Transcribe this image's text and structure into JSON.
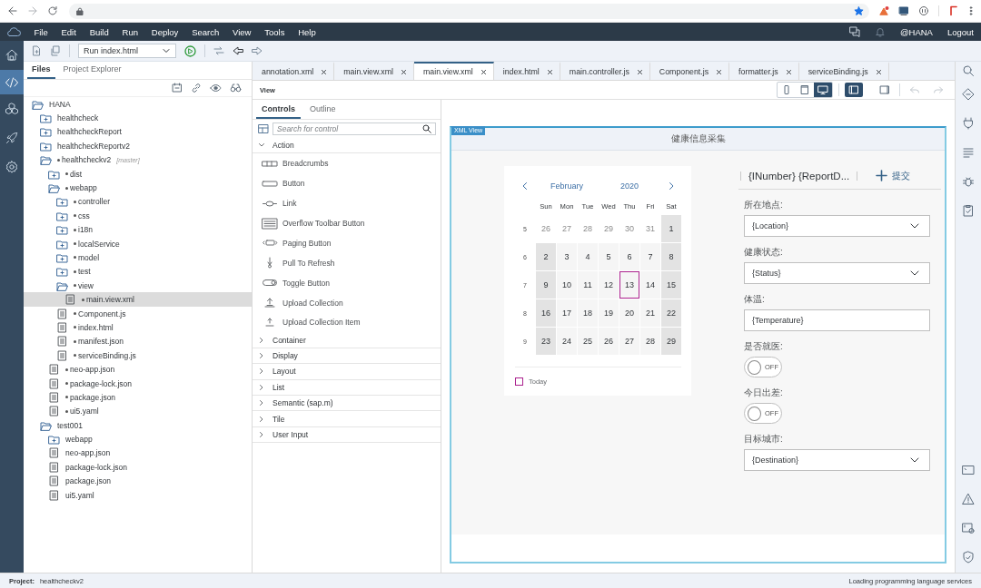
{
  "menubar": {
    "menus": [
      "File",
      "Edit",
      "Build",
      "Run",
      "Deploy",
      "Search",
      "View",
      "Tools",
      "Help"
    ],
    "user": "@HANA",
    "logout": "Logout"
  },
  "left_rail": [
    {
      "selected": false
    },
    {
      "selected": true
    },
    {
      "selected": false
    },
    {
      "selected": false
    },
    {
      "selected": false
    }
  ],
  "toolbar": {
    "run_config": "Run index.html"
  },
  "files": {
    "tabs": [
      {
        "label": "Files",
        "selected": true
      },
      {
        "label": "Project Explorer",
        "selected": false
      }
    ],
    "tree": [
      {
        "name": "HANA",
        "kind": "folder",
        "expanded": true,
        "modified": false,
        "selected": false,
        "children": [
          {
            "name": "healthcheck",
            "kind": "folder",
            "expanded": false,
            "modified": false,
            "selected": false
          },
          {
            "name": "healthcheckReport",
            "kind": "folder",
            "expanded": false,
            "modified": false,
            "selected": false
          },
          {
            "name": "healthcheckReportv2",
            "kind": "folder",
            "expanded": false,
            "modified": false,
            "selected": false
          },
          {
            "name": "healthcheckv2",
            "kind": "folder",
            "expanded": true,
            "modified": true,
            "selected": false,
            "branch": "[master]",
            "children": [
              {
                "name": "dist",
                "kind": "folder",
                "expanded": false,
                "modified": true,
                "selected": false
              },
              {
                "name": "webapp",
                "kind": "folder",
                "expanded": true,
                "modified": true,
                "selected": false,
                "children": [
                  {
                    "name": "controller",
                    "kind": "folder",
                    "expanded": false,
                    "modified": true,
                    "selected": false
                  },
                  {
                    "name": "css",
                    "kind": "folder",
                    "expanded": false,
                    "modified": true,
                    "selected": false
                  },
                  {
                    "name": "i18n",
                    "kind": "folder",
                    "expanded": false,
                    "modified": true,
                    "selected": false
                  },
                  {
                    "name": "localService",
                    "kind": "folder",
                    "expanded": false,
                    "modified": true,
                    "selected": false
                  },
                  {
                    "name": "model",
                    "kind": "folder",
                    "expanded": false,
                    "modified": true,
                    "selected": false
                  },
                  {
                    "name": "test",
                    "kind": "folder",
                    "expanded": false,
                    "modified": true,
                    "selected": false
                  },
                  {
                    "name": "view",
                    "kind": "folder",
                    "expanded": true,
                    "modified": true,
                    "selected": false,
                    "children": [
                      {
                        "name": "main.view.xml",
                        "kind": "file",
                        "modified": true,
                        "selected": true
                      }
                    ]
                  },
                  {
                    "name": "Component.js",
                    "kind": "file",
                    "modified": true,
                    "selected": false
                  },
                  {
                    "name": "index.html",
                    "kind": "file",
                    "modified": true,
                    "selected": false
                  },
                  {
                    "name": "manifest.json",
                    "kind": "file",
                    "modified": true,
                    "selected": false
                  },
                  {
                    "name": "serviceBinding.js",
                    "kind": "file",
                    "modified": true,
                    "selected": false
                  }
                ]
              },
              {
                "name": "neo-app.json",
                "kind": "file",
                "modified": true,
                "selected": false
              },
              {
                "name": "package-lock.json",
                "kind": "file",
                "modified": true,
                "selected": false
              },
              {
                "name": "package.json",
                "kind": "file",
                "modified": true,
                "selected": false
              },
              {
                "name": "ui5.yaml",
                "kind": "file",
                "modified": true,
                "selected": false
              }
            ]
          },
          {
            "name": "test001",
            "kind": "folder",
            "expanded": true,
            "modified": false,
            "selected": false,
            "children": [
              {
                "name": "webapp",
                "kind": "folder",
                "expanded": false,
                "modified": false,
                "selected": false
              },
              {
                "name": "neo-app.json",
                "kind": "file",
                "modified": false,
                "selected": false
              },
              {
                "name": "package-lock.json",
                "kind": "file",
                "modified": false,
                "selected": false
              },
              {
                "name": "package.json",
                "kind": "file",
                "modified": false,
                "selected": false
              },
              {
                "name": "ui5.yaml",
                "kind": "file",
                "modified": false,
                "selected": false
              }
            ]
          }
        ]
      }
    ]
  },
  "editor_tabs": [
    {
      "label": "annotation.xml",
      "selected": false
    },
    {
      "label": "main.view.xml",
      "selected": false
    },
    {
      "label": "main.view.xml",
      "selected": true
    },
    {
      "label": "index.html",
      "selected": false
    },
    {
      "label": "main.controller.js",
      "selected": false
    },
    {
      "label": "Component.js",
      "selected": false
    },
    {
      "label": "formatter.js",
      "selected": false
    },
    {
      "label": "serviceBinding.js",
      "selected": false
    }
  ],
  "view_toolbar": {
    "label": "View",
    "devices": [
      {
        "selected": false
      },
      {
        "selected": false
      },
      {
        "selected": true
      }
    ],
    "panes": [
      {
        "selected": true
      },
      {
        "selected": false
      }
    ],
    "history": [
      {
        "disabled": true
      },
      {
        "disabled": true
      }
    ]
  },
  "controls": {
    "tabs": [
      {
        "label": "Controls",
        "selected": true
      },
      {
        "label": "Outline",
        "selected": false
      }
    ],
    "search": {
      "placeholder": "Search for control"
    },
    "groups": [
      {
        "label": "Action",
        "expanded": true,
        "items": [
          {
            "label": "Breadcrumbs"
          },
          {
            "label": "Button"
          },
          {
            "label": "Link"
          },
          {
            "label": "Overflow Toolbar Button"
          },
          {
            "label": "Paging Button"
          },
          {
            "label": "Pull To Refresh"
          },
          {
            "label": "Toggle Button"
          },
          {
            "label": "Upload Collection"
          },
          {
            "label": "Upload Collection Item"
          }
        ]
      },
      {
        "label": "Container",
        "expanded": false
      },
      {
        "label": "Display",
        "expanded": false
      },
      {
        "label": "Layout",
        "expanded": false
      },
      {
        "label": "List",
        "expanded": false
      },
      {
        "label": "Semantic (sap.m)",
        "expanded": false
      },
      {
        "label": "Tile",
        "expanded": false
      },
      {
        "label": "User Input",
        "expanded": false
      }
    ]
  },
  "preview": {
    "badge": "XML View",
    "title": "健康信息采集",
    "calendar": {
      "month": "February",
      "year": "2020",
      "weekdays": [
        "Sun",
        "Mon",
        "Tue",
        "Wed",
        "Thu",
        "Fri",
        "Sat"
      ],
      "weeks": [
        {
          "number": "5",
          "days": [
            {
              "label": "26",
              "kind": "other",
              "today": false
            },
            {
              "label": "27",
              "kind": "other",
              "today": false
            },
            {
              "label": "28",
              "kind": "other",
              "today": false
            },
            {
              "label": "29",
              "kind": "other",
              "today": false
            },
            {
              "label": "30",
              "kind": "other",
              "today": false
            },
            {
              "label": "31",
              "kind": "other",
              "today": false
            },
            {
              "label": "1",
              "kind": "weekend",
              "today": false
            }
          ]
        },
        {
          "number": "6",
          "days": [
            {
              "label": "2",
              "kind": "weekend",
              "today": false
            },
            {
              "label": "3",
              "kind": "day",
              "today": false
            },
            {
              "label": "4",
              "kind": "day",
              "today": false
            },
            {
              "label": "5",
              "kind": "day",
              "today": false
            },
            {
              "label": "6",
              "kind": "day",
              "today": false
            },
            {
              "label": "7",
              "kind": "day",
              "today": false
            },
            {
              "label": "8",
              "kind": "weekend",
              "today": false
            }
          ]
        },
        {
          "number": "7",
          "days": [
            {
              "label": "9",
              "kind": "weekend",
              "today": false
            },
            {
              "label": "10",
              "kind": "day",
              "today": false
            },
            {
              "label": "11",
              "kind": "day",
              "today": false
            },
            {
              "label": "12",
              "kind": "day",
              "today": false
            },
            {
              "label": "13",
              "kind": "day",
              "today": true
            },
            {
              "label": "14",
              "kind": "day",
              "today": false
            },
            {
              "label": "15",
              "kind": "weekend",
              "today": false
            }
          ]
        },
        {
          "number": "8",
          "days": [
            {
              "label": "16",
              "kind": "weekend",
              "today": false
            },
            {
              "label": "17",
              "kind": "day",
              "today": false
            },
            {
              "label": "18",
              "kind": "day",
              "today": false
            },
            {
              "label": "19",
              "kind": "day",
              "today": false
            },
            {
              "label": "20",
              "kind": "day",
              "today": false
            },
            {
              "label": "21",
              "kind": "day",
              "today": false
            },
            {
              "label": "22",
              "kind": "weekend",
              "today": false
            }
          ]
        },
        {
          "number": "9",
          "days": [
            {
              "label": "23",
              "kind": "weekend",
              "today": false
            },
            {
              "label": "24",
              "kind": "day",
              "today": false
            },
            {
              "label": "25",
              "kind": "day",
              "today": false
            },
            {
              "label": "26",
              "kind": "day",
              "today": false
            },
            {
              "label": "27",
              "kind": "day",
              "today": false
            },
            {
              "label": "28",
              "kind": "day",
              "today": false
            },
            {
              "label": "29",
              "kind": "weekend",
              "today": false
            }
          ]
        }
      ],
      "legend": "Today"
    },
    "form": {
      "title": "{INumber} {ReportD...",
      "action": "提交",
      "fields": [
        {
          "label": "所在地点:",
          "kind": "select",
          "value": "{Location}"
        },
        {
          "label": "健康状态:",
          "kind": "select",
          "value": "{Status}"
        },
        {
          "label": "体温:",
          "kind": "input",
          "value": "{Temperature}"
        },
        {
          "label": "是否就医:",
          "kind": "switch",
          "on": false,
          "state_text": "OFF"
        },
        {
          "label": "今日出差:",
          "kind": "switch",
          "on": false,
          "state_text": "OFF"
        },
        {
          "label": "目标城市:",
          "kind": "select",
          "value": "{Destination}"
        }
      ]
    }
  },
  "status_bar": {
    "project_label": "Project:",
    "project": "healthcheckv2",
    "message": "Loading programming language services"
  }
}
